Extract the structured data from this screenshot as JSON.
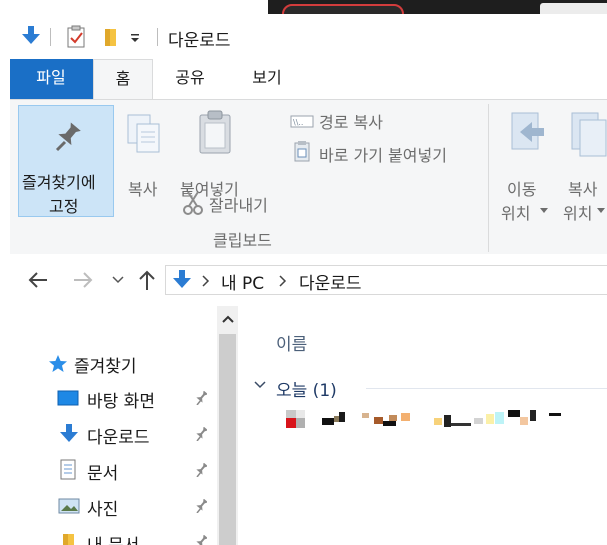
{
  "window": {
    "title": "다운로드"
  },
  "ribbon_tabs": [
    "파일",
    "홈",
    "공유",
    "보기"
  ],
  "ribbon": {
    "pin_line1": "즐겨찾기에",
    "pin_line2": "고정",
    "copy": "복사",
    "paste": "붙여넣기",
    "copy_path": "경로 복사",
    "paste_shortcut": "바로 가기 붙여넣기",
    "cut": "잘라내기",
    "clipboard_group": "클립보드",
    "move_line1": "이동",
    "move_line2": "위치",
    "copyto_line1": "복사",
    "copyto_line2": "위치"
  },
  "address": {
    "pc": "내 PC",
    "folder": "다운로드"
  },
  "nav": {
    "quick_access": "즐겨찾기",
    "items": [
      "바탕 화면",
      "다운로드",
      "문서",
      "사진",
      "내 문서"
    ]
  },
  "content": {
    "column_name": "이름",
    "group_label": "오늘 (1)"
  },
  "colors": {
    "accent": "#1a6fc6",
    "selected": "#cce4f7"
  }
}
